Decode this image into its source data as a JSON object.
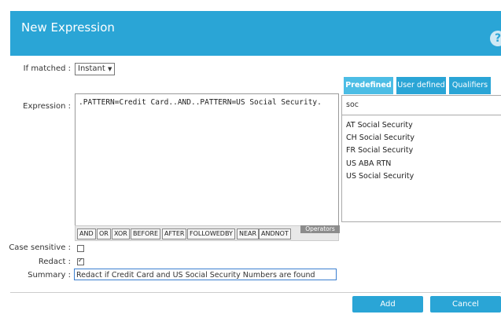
{
  "dialog": {
    "title": "New Expression",
    "help_glyph": "?"
  },
  "fields": {
    "if_matched_label": "If matched :",
    "if_matched_value": "Instant",
    "if_matched_arrow": "▼",
    "expression_label": "Expression :",
    "expression_value": ".PATTERN=Credit Card..AND..PATTERN=US Social Security.",
    "case_sensitive_label": "Case sensitive :",
    "redact_label": "Redact :",
    "summary_label": "Summary :",
    "summary_value": "Redact if Credit Card and US Social Security Numbers are found"
  },
  "operators": {
    "tag": "Operators",
    "items": [
      "AND",
      "OR",
      "XOR",
      "BEFORE",
      "AFTER",
      "FOLLOWEDBY",
      "NEAR",
      "ANDNOT"
    ]
  },
  "tabs": [
    "Predefined",
    "User defined",
    "Qualifiers"
  ],
  "patterns": {
    "search_value": "soc",
    "items": [
      "AT Social Security",
      "CH Social Security",
      "FR Social Security",
      "US ABA RTN",
      "US Social Security"
    ]
  },
  "checkboxes": {
    "case_sensitive": false,
    "redact": true
  },
  "buttons": {
    "add": "Add",
    "cancel": "Cancel"
  }
}
